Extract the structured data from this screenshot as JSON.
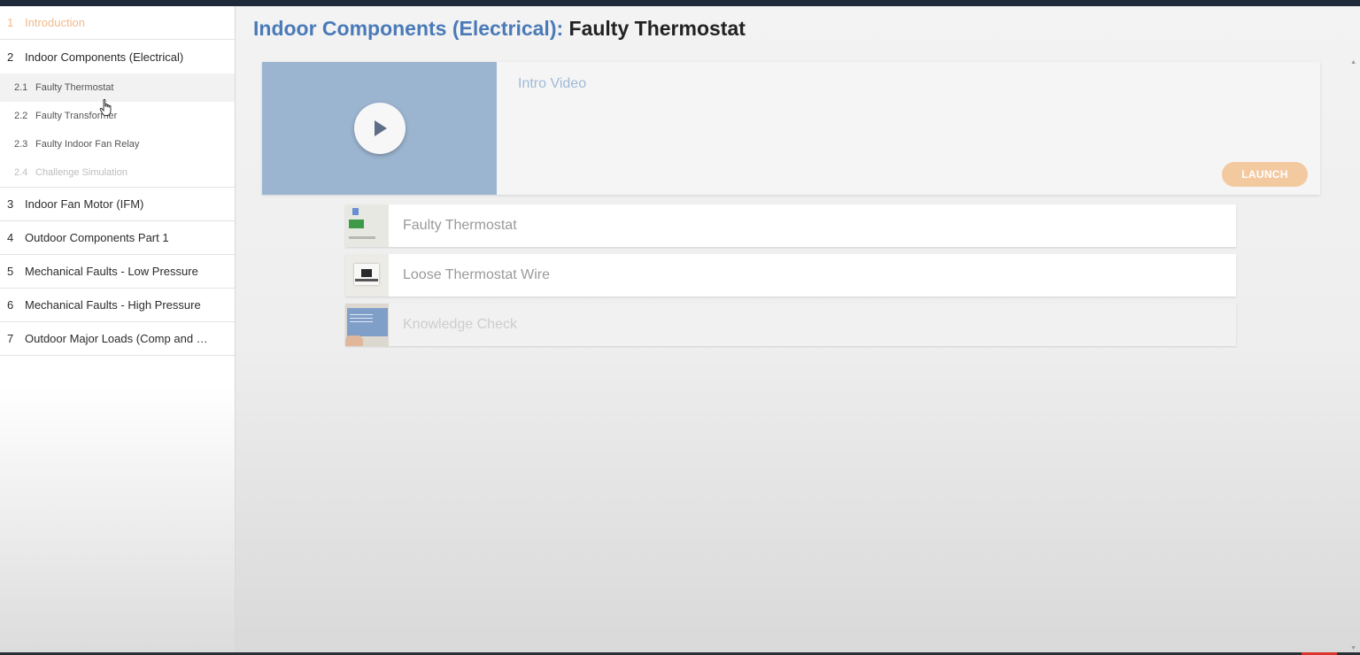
{
  "sidebar": {
    "sections": [
      {
        "num": "1",
        "label": "Introduction"
      },
      {
        "num": "2",
        "label": "Indoor Components (Electrical)"
      },
      {
        "num": "3",
        "label": "Indoor Fan Motor (IFM)"
      },
      {
        "num": "4",
        "label": "Outdoor Components Part 1"
      },
      {
        "num": "5",
        "label": "Mechanical Faults - Low Pressure"
      },
      {
        "num": "6",
        "label": "Mechanical Faults - High Pressure"
      },
      {
        "num": "7",
        "label": "Outdoor Major Loads (Comp and O..."
      }
    ],
    "subitems": [
      {
        "num": "2.1",
        "label": "Faulty Thermostat"
      },
      {
        "num": "2.2",
        "label": "Faulty Transformer"
      },
      {
        "num": "2.3",
        "label": "Faulty Indoor Fan Relay"
      },
      {
        "num": "2.4",
        "label": "Challenge Simulation"
      }
    ]
  },
  "header": {
    "crumb": "Indoor Components (Electrical):",
    "current": "Faulty Thermostat"
  },
  "hero": {
    "title": "Intro Video",
    "launch_label": "LAUNCH"
  },
  "lessons": [
    {
      "title": "Faulty Thermostat"
    },
    {
      "title": "Loose Thermostat Wire"
    },
    {
      "title": "Knowledge Check"
    }
  ],
  "colors": {
    "accent_blue": "#4a7ab8",
    "intro_orange": "#f3b98a",
    "launch_peach": "#f3c9a0",
    "video_blue": "#9bb4cf"
  }
}
